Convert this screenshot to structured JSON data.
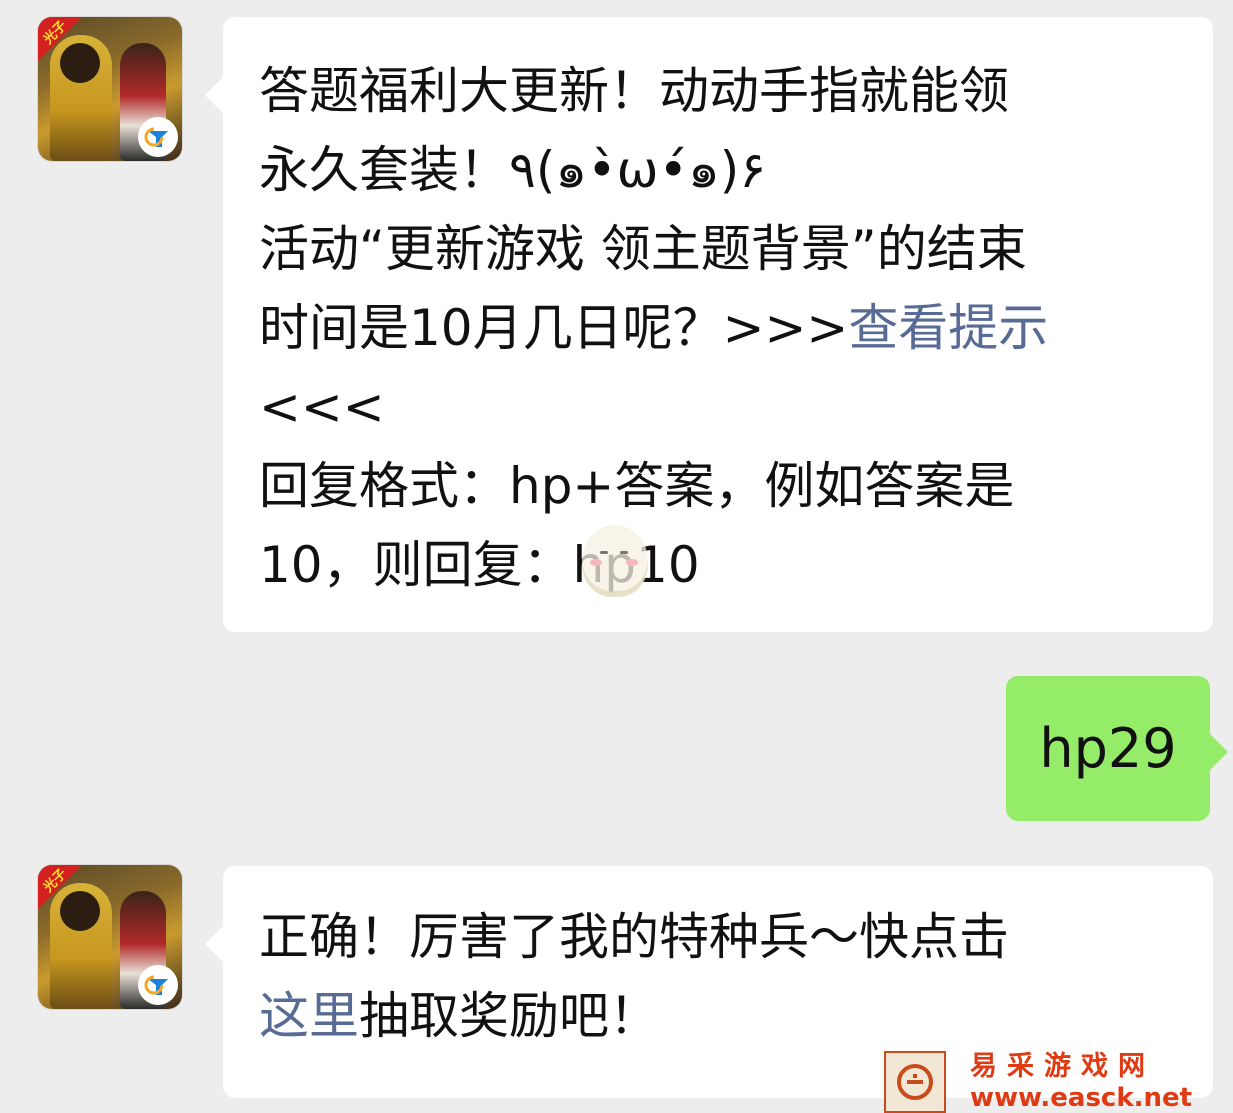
{
  "messages": [
    {
      "sender": "bot",
      "avatar_tag": "光子",
      "lines": [
        "答题福利大更新！动动手指就能领",
        "永久套装！٩(๑•̀ω•́๑)۶",
        "活动“更新游戏 领主题背景”的结束"
      ],
      "line4_prefix": "时间是10月几日呢？>>>",
      "line4_link": "查看提示",
      "line5": "<<<",
      "line6": "回复格式：hp+答案，例如答案是",
      "line7": "10，则回复：hp10"
    },
    {
      "sender": "me",
      "text": "hp29"
    },
    {
      "sender": "bot",
      "avatar_tag": "光子",
      "line1": "正确！厉害了我的特种兵～快点击",
      "line2_link": "这里",
      "line2_suffix": "抽取奖励吧！"
    }
  ],
  "watermark": {
    "cn": "易采游戏网",
    "en": "www.easck.net"
  },
  "colors": {
    "background": "#ededed",
    "bubble_bot": "#ffffff",
    "bubble_me": "#95ec69",
    "link": "#576b95",
    "watermark": "#e03a12"
  },
  "icons": [
    "game-avatar-icon",
    "tencent-games-logo-icon",
    "mascot-sticker-icon",
    "site-logo-icon"
  ]
}
